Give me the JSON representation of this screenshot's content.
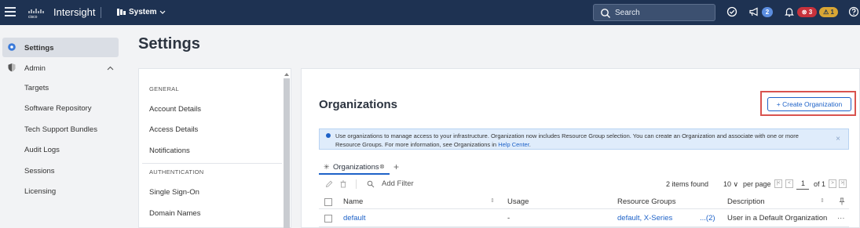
{
  "topbar": {
    "brand": "Intersight",
    "cisco_logo": "cisco",
    "system_label": "System",
    "search_placeholder": "Search",
    "announcements_count": "2",
    "alarms_critical": "3",
    "alarms_warning": "1",
    "alarm_critical_symbol": "⊗",
    "alarm_warning_symbol": "⚠"
  },
  "sidebar": {
    "items": [
      {
        "label": "Settings",
        "icon": "gear-icon",
        "selected": true
      },
      {
        "label": "Admin",
        "icon": "shield-icon",
        "expanded": true
      },
      {
        "label": "Targets"
      },
      {
        "label": "Software Repository"
      },
      {
        "label": "Tech Support Bundles"
      },
      {
        "label": "Audit Logs"
      },
      {
        "label": "Sessions"
      },
      {
        "label": "Licensing"
      }
    ]
  },
  "page": {
    "title": "Settings"
  },
  "settings_menu": {
    "sections": [
      {
        "title": "GENERAL",
        "items": [
          "Account Details",
          "Access Details",
          "Notifications"
        ]
      },
      {
        "title": "AUTHENTICATION",
        "items": [
          "Single Sign-On",
          "Domain Names"
        ]
      }
    ]
  },
  "main": {
    "title": "Organizations",
    "create_button": "+ Create Organization",
    "info": {
      "text": "Use organizations to manage access to your infrastructure. Organization now includes Resource Group selection. You can create an Organization and associate with one or more Resource Groups. For more information, see Organizations in",
      "link": "Help Center",
      "end": "."
    },
    "tab": {
      "label": "Organizations"
    },
    "toolbar": {
      "filter_placeholder": "Add Filter",
      "items_found": "2 items found",
      "per_page_value": "10",
      "per_page_label": "per page",
      "page": "1",
      "of_pages": "of 1"
    },
    "table": {
      "columns": [
        "Name",
        "Usage",
        "Resource Groups",
        "Description"
      ],
      "rows": [
        {
          "name": "default",
          "usage": "-",
          "resource_groups": "default, X-Series",
          "resource_groups_more": "...(2)",
          "description": "User in a Default Organization a"
        }
      ]
    }
  }
}
